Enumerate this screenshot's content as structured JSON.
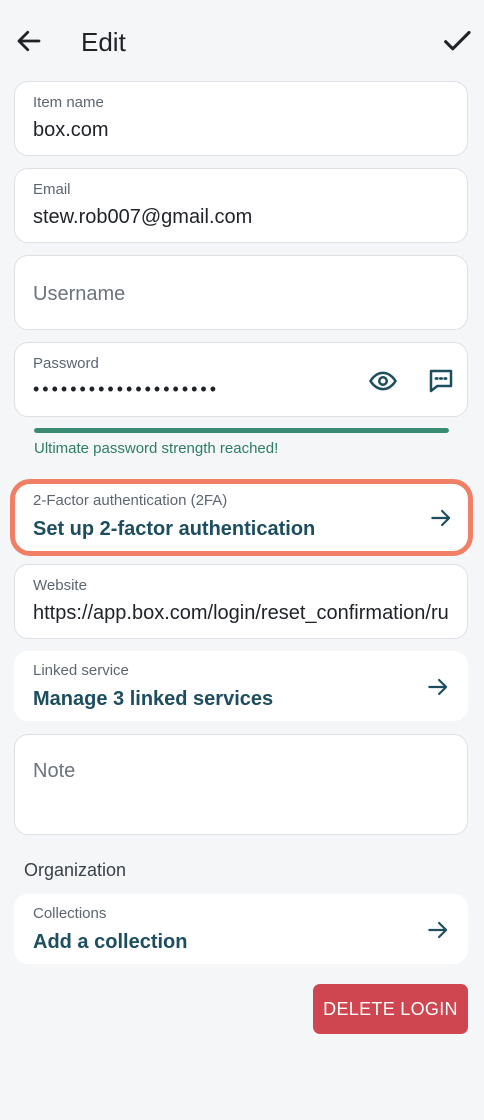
{
  "header": {
    "title": "Edit",
    "back_icon": "arrow-left-icon",
    "save_icon": "check-icon"
  },
  "item_name": {
    "label": "Item name",
    "value": "box.com"
  },
  "email": {
    "label": "Email",
    "value": "stew.rob007@gmail.com"
  },
  "username": {
    "placeholder": "Username",
    "value": ""
  },
  "password": {
    "label": "Password",
    "masked_value": "••••••••••••••••••••",
    "reveal_icon": "eye-icon",
    "generate_icon": "message-icon",
    "strength_text": "Ultimate password strength reached!",
    "strength_fraction": 1.0,
    "strength_color": "#3d8a72"
  },
  "two_factor": {
    "label": "2-Factor authentication (2FA)",
    "action": "Set up 2-factor authentication",
    "highlight_color": "#f07f66"
  },
  "website": {
    "label": "Website",
    "value": "https://app.box.com/login/reset_confirmation/ru"
  },
  "linked_service": {
    "label": "Linked service",
    "action": "Manage 3 linked services"
  },
  "note": {
    "placeholder": "Note"
  },
  "organization": {
    "title": "Organization",
    "collections": {
      "label": "Collections",
      "action": "Add a collection"
    }
  },
  "delete_button": {
    "label": "DELETE LOGIN",
    "color": "#cf4550"
  },
  "colors": {
    "background": "#f4f6f8",
    "link": "#1d4e60",
    "accent": "#2e7d62"
  }
}
